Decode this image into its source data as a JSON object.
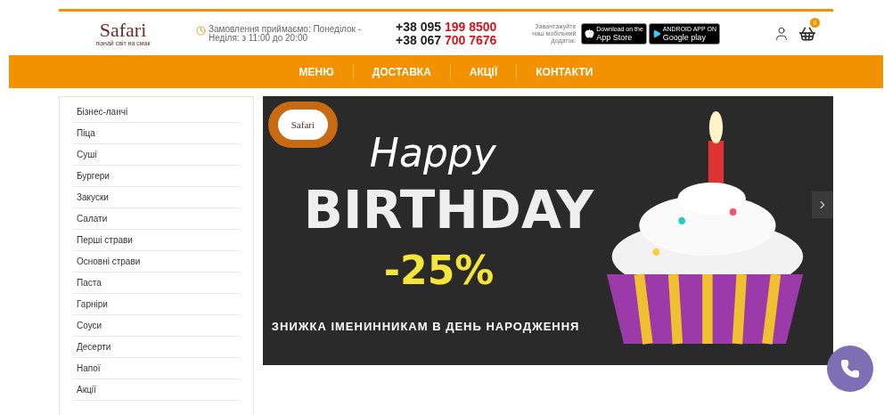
{
  "header": {
    "logo": {
      "name": "Safari",
      "tagline": "пізнай світ на смак"
    },
    "hours": "Замовлення приймаємо: Понеділок - Неділя: з 11:00 до 20:00",
    "phones": [
      {
        "prefix": "+38 095",
        "number": "199 8500"
      },
      {
        "prefix": "+38 067",
        "number": "700 7676"
      }
    ],
    "app_promo": "Завантажуйте наш мобільний додаток:",
    "stores": [
      {
        "kind": "apple",
        "small": "Download on the",
        "big": "App Store"
      },
      {
        "kind": "google",
        "small": "ANDROID APP ON",
        "big": "Google play"
      }
    ],
    "cart_count": "0"
  },
  "nav": [
    "МЕНЮ",
    "ДОСТАВКА",
    "АКЦІЇ",
    "КОНТАКТИ"
  ],
  "categories": [
    "Бізнес-ланчі",
    "Піца",
    "Суші",
    "Бургери",
    "Закуски",
    "Салати",
    "Перші страви",
    "Основні страви",
    "Паста",
    "Гарніри",
    "Соуси",
    "Десерти",
    "Напої",
    "Акції"
  ],
  "banner": {
    "logo": "Safari",
    "line1": "Happy",
    "line2": "BIRTHDAY",
    "discount": "-25%",
    "caption": "ЗНИЖКА ІМЕНИННИКАМ В ДЕНЬ НАРОДЖЕННЯ"
  }
}
